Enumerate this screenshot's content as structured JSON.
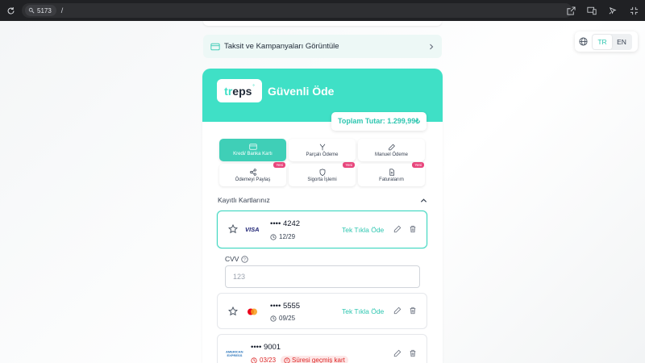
{
  "browser": {
    "port": "5173",
    "path": "/"
  },
  "lang": {
    "tr": "TR",
    "en": "EN",
    "active": "TR"
  },
  "installments_label": "Taksit ve Kampanyaları Görüntüle",
  "header": {
    "logo": "treps",
    "logo_mark": "°",
    "title": "Güvenli Öde",
    "total": "Toplam Tutar: 1.299,99₺"
  },
  "methods": [
    {
      "label": "Kredi/ Banka Kartı",
      "icon": "credit-card-icon",
      "active": true,
      "badge": ""
    },
    {
      "label": "Parçalı Ödeme",
      "icon": "split-arrows-icon",
      "active": false,
      "badge": ""
    },
    {
      "label": "Manuel Ödeme",
      "icon": "pen-icon",
      "active": false,
      "badge": ""
    },
    {
      "label": "Ödemeyi Paylaş",
      "icon": "share-icon",
      "active": false,
      "badge": "Yeni"
    },
    {
      "label": "Sigorta İşlemi",
      "icon": "shield-icon",
      "active": false,
      "badge": "Yeni"
    },
    {
      "label": "Faturalarım",
      "icon": "document-icon",
      "active": false,
      "badge": "Yeni"
    }
  ],
  "saved": {
    "title": "Kayıtlı Kartlarınız",
    "cards": [
      {
        "brand": "VISA",
        "number": "•••• 4242",
        "expiry": "12/29",
        "action": "Tek Tıkla Öde",
        "expired": false
      },
      {
        "brand": "Mastercard",
        "number": "•••• 5555",
        "expiry": "09/25",
        "action": "Tek Tıkla Öde",
        "expired": false
      },
      {
        "brand": "AMERICAN EXPRESS",
        "number": "•••• 9001",
        "expiry": "03/23",
        "expired_label": "Süresi geçmiş kart",
        "expired": true
      }
    ]
  },
  "cvv": {
    "label": "CVV",
    "placeholder": "123"
  },
  "colors": {
    "accent": "#3fe0c6",
    "accent_text": "#2dc6b0",
    "badge": "#e8467c",
    "danger": "#dc2626"
  }
}
